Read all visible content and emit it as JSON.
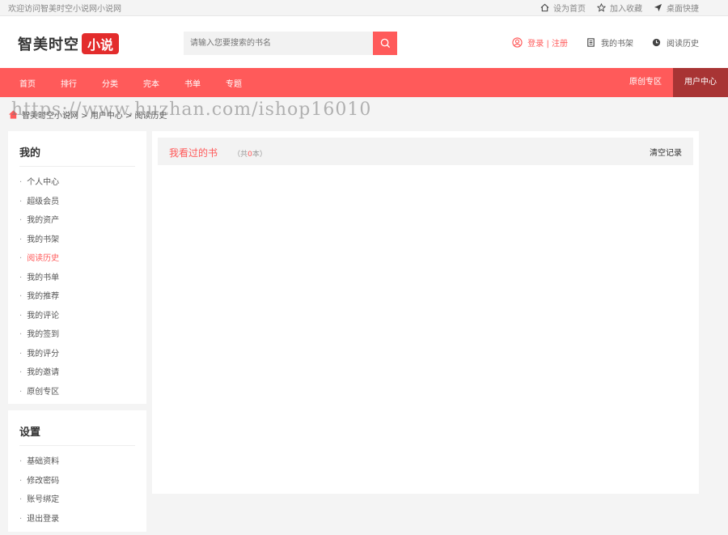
{
  "topbar": {
    "welcome": "欢迎访问智美时空小说网小说网",
    "set_home": "设为首页",
    "bookmark": "加入收藏",
    "desktop": "桌面快捷"
  },
  "header": {
    "logo_text": "智美时空",
    "logo_badge": "小说",
    "search_placeholder": "请输入您要搜索的书名",
    "login": "登录 | 注册",
    "my_shelf": "我的书架",
    "history": "阅读历史"
  },
  "nav": {
    "items": [
      "首页",
      "排行",
      "分类",
      "完本",
      "书单",
      "专题"
    ],
    "original": "原创专区",
    "user_center": "用户中心"
  },
  "breadcrumb": {
    "text": "智美时空小说网 > 用户中心 > 阅读历史",
    "watermark": "https://www.huzhan.com/ishop16010"
  },
  "sidebar": {
    "mine_title": "我的",
    "mine_items": [
      "个人中心",
      "超级会员",
      "我的资产",
      "我的书架",
      "阅读历史",
      "我的书单",
      "我的推荐",
      "我的评论",
      "我的签到",
      "我的评分",
      "我的邀请",
      "原创专区"
    ],
    "settings_title": "设置",
    "settings_items": [
      "基础资料",
      "修改密码",
      "账号绑定",
      "退出登录"
    ]
  },
  "main": {
    "title": "我看过的书",
    "count_prefix": "（共",
    "count": "0",
    "count_suffix": "本）",
    "clear": "清空记录"
  },
  "colors": {
    "accent": "#ff5a5a",
    "nav_active": "#a83434",
    "logo_badge": "#e32c2c"
  }
}
